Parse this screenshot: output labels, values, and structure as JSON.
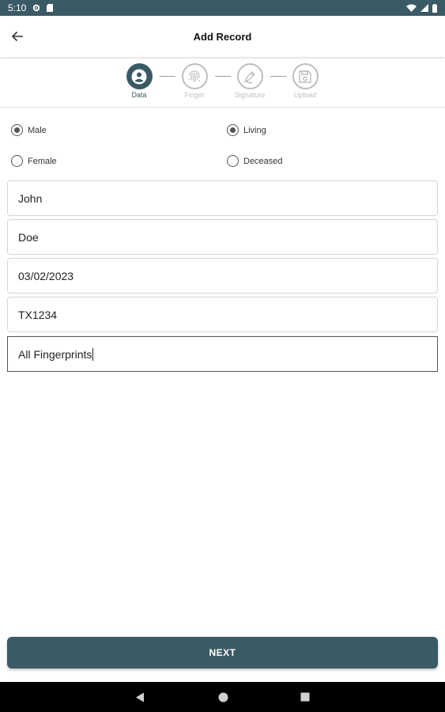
{
  "status_bar": {
    "time": "5:10",
    "icons": [
      "gear-icon",
      "sd-card-icon",
      "wifi-icon",
      "signal-icon",
      "battery-icon"
    ]
  },
  "app_bar": {
    "title": "Add Record",
    "back_icon": "arrow-back-icon"
  },
  "stepper": {
    "steps": [
      {
        "label": "Data",
        "icon": "person-icon",
        "active": true
      },
      {
        "label": "Finger",
        "icon": "fingerprint-icon",
        "active": false
      },
      {
        "label": "Signature",
        "icon": "pen-icon",
        "active": false
      },
      {
        "label": "Upload",
        "icon": "save-icon",
        "active": false
      }
    ]
  },
  "gender": {
    "options": [
      {
        "label": "Male",
        "checked": true
      },
      {
        "label": "Female",
        "checked": false
      }
    ]
  },
  "status": {
    "options": [
      {
        "label": "Living",
        "checked": true
      },
      {
        "label": "Deceased",
        "checked": false
      }
    ]
  },
  "fields": [
    {
      "value": "John"
    },
    {
      "value": "Doe"
    },
    {
      "value": "03/02/2023"
    },
    {
      "value": "TX1234"
    },
    {
      "value": "All Fingerprints",
      "focused": true
    }
  ],
  "next_button": {
    "label": "NEXT"
  },
  "colors": {
    "primary": "#3a5a65",
    "inactive": "#bdbdbd"
  }
}
